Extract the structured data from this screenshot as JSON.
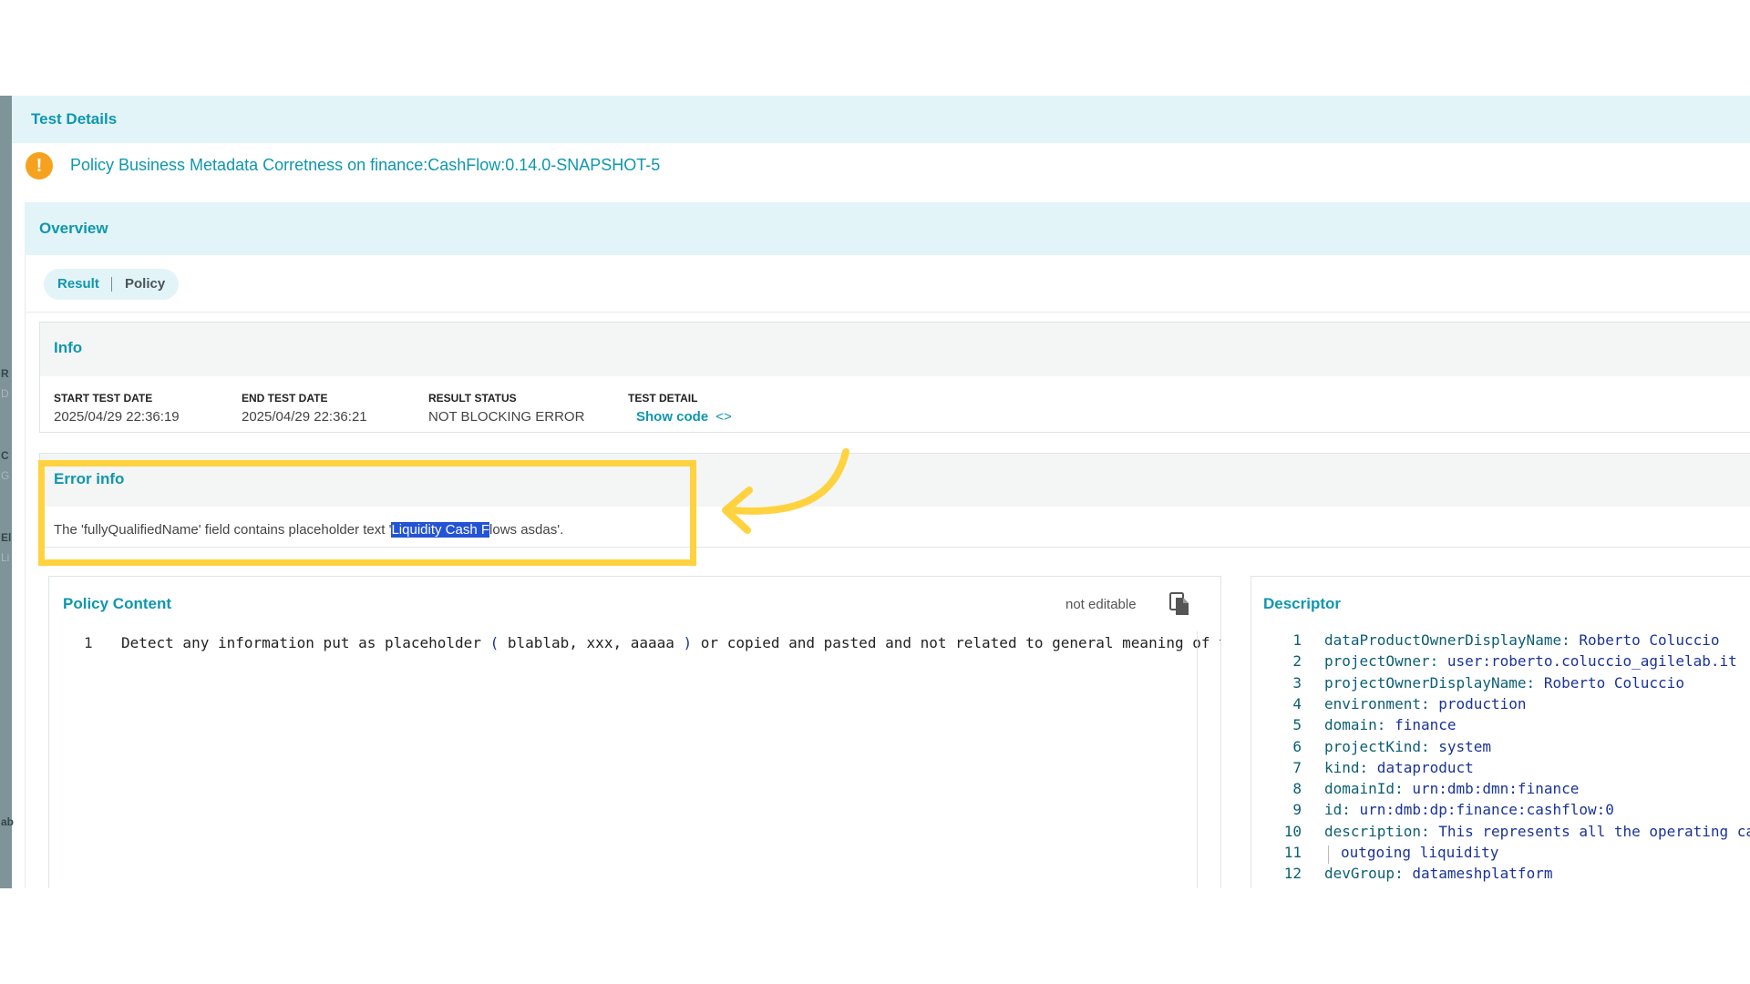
{
  "sidebar_fragments": [
    "R",
    "D",
    "C",
    "G",
    "El",
    "Li",
    "ab"
  ],
  "test_details": {
    "title": "Test Details"
  },
  "policy": {
    "warning_icon": "exclamation-circle-icon",
    "title": "Policy Business Metadata Corretness on finance:CashFlow:0.14.0-SNAPSHOT-5"
  },
  "overview": {
    "title": "Overview",
    "tabs": {
      "result": "Result",
      "policy": "Policy"
    }
  },
  "info": {
    "title": "Info",
    "start_label": "START TEST DATE",
    "start_value": "2025/04/29 22:36:19",
    "end_label": "END TEST DATE",
    "end_value": "2025/04/29 22:36:21",
    "status_label": "RESULT STATUS",
    "status_value": "NOT BLOCKING ERROR",
    "detail_label": "TEST DETAIL",
    "show_code": "Show code",
    "show_code_icon": "<>"
  },
  "error_info": {
    "title": "Error info",
    "msg_before": "The 'fullyQualifiedName' field contains placeholder text '",
    "msg_selected": "Liquidity Cash F",
    "msg_after": "lows asdas'."
  },
  "policy_content": {
    "title": "Policy Content",
    "not_editable": "not editable",
    "copy_icon": "copy-icon",
    "line_number": "1",
    "code_a": "Detect any information put as placeholder ",
    "paren_open": "(",
    "code_b": " blablab, xxx, aaaaa ",
    "paren_close": ")",
    "code_c": " or copied and pasted and not related to general meaning of th"
  },
  "descriptor": {
    "title": "Descriptor",
    "lines": [
      {
        "n": "1",
        "k": "dataProductOwnerDisplayName",
        "v": "Roberto Coluccio"
      },
      {
        "n": "2",
        "k": "projectOwner",
        "v": "user:roberto.coluccio_agilelab.it"
      },
      {
        "n": "3",
        "k": "projectOwnerDisplayName",
        "v": "Roberto Coluccio"
      },
      {
        "n": "4",
        "k": "environment",
        "v": "production"
      },
      {
        "n": "5",
        "k": "domain",
        "v": "finance"
      },
      {
        "n": "6",
        "k": "projectKind",
        "v": "system"
      },
      {
        "n": "7",
        "k": "kind",
        "v": "dataproduct"
      },
      {
        "n": "8",
        "k": "domainId",
        "v": "urn:dmb:dmn:finance"
      },
      {
        "n": "9",
        "k": "id",
        "v": "urn:dmb:dp:finance:cashflow:0"
      },
      {
        "n": "10",
        "k": "description",
        "v": "This represents all the operating cas"
      },
      {
        "n": "11",
        "k": "",
        "v": "outgoing liquidity"
      },
      {
        "n": "12",
        "k": "devGroup",
        "v": "datameshplatform"
      }
    ]
  }
}
